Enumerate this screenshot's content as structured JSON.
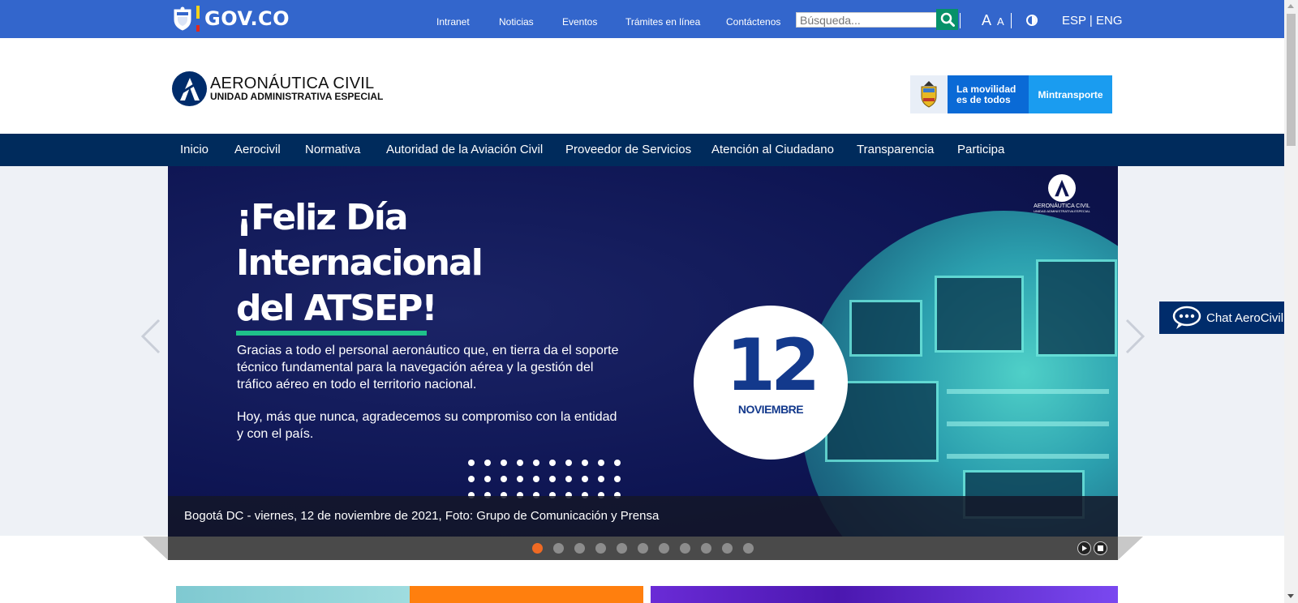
{
  "govbar": {
    "logo_text": "GOV.CO",
    "links": [
      "Intranet",
      "Noticias",
      "Eventos",
      "Trámites en línea",
      "Contáctenos"
    ],
    "search_placeholder": "Búsqueda...",
    "font_large": "A",
    "font_small": "A",
    "lang_esp": "ESP",
    "lang_sep": "|",
    "lang_eng": "ENG",
    "color": "#3366cc"
  },
  "header": {
    "logo_title": "AERONÁUTICA CIVIL",
    "logo_subtitle": "UNIDAD ADMINISTRATIVA ESPECIAL",
    "mintransporte_slogan_1": "La movilidad",
    "mintransporte_slogan_2": "es de todos",
    "mintransporte_label": "Mintransporte"
  },
  "mainnav": {
    "items": [
      "Inicio",
      "Aerocivil",
      "Normativa",
      "Autoridad de la Aviación Civil",
      "Proveedor de Servicios",
      "Atención al Ciudadano",
      "Transparencia",
      "Participa"
    ],
    "color": "#002b5c"
  },
  "slide": {
    "headline_1": "¡Feliz Día",
    "headline_2": "Internacional",
    "headline_3": "del ATSEP!",
    "body_1": "Gracias a todo el personal aeronáutico que, en tierra da el soporte técnico fundamental para la navegación aérea y la gestión del tráfico aéreo en todo el territorio nacional.",
    "body_2": "Hoy, más que nunca, agradecemos su compromiso con la entidad y con el país.",
    "date_number": "12",
    "date_month": "NOVIEMBRE",
    "logo_line_1": "AERONÁUTICA CIVIL",
    "logo_line_2": "UNIDAD ADMINISTRATIVA ESPECIAL",
    "caption": "Bogotá DC - viernes, 12 de noviembre de 2021, Foto: Grupo de Comunicación y Prensa"
  },
  "slider": {
    "page_count": 11,
    "active_page": 1,
    "active_color": "#f06a23"
  },
  "chat": {
    "label": "Chat AeroCivil"
  }
}
